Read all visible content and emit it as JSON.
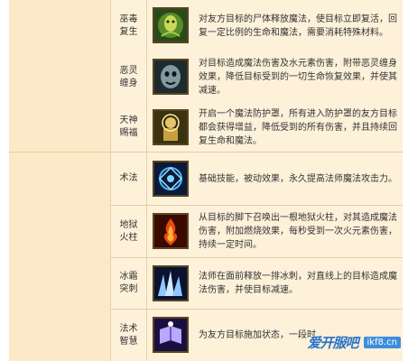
{
  "skills": [
    {
      "name_lines": [
        "巫毒",
        "复生"
      ],
      "icon": "voodoo-revive-icon",
      "description": "对友方目标的尸体释放魔法，使目标立即复活，回复一定比例的生命和魔法，需要消耗特殊材料。"
    },
    {
      "name_lines": [
        "恶灵",
        "缠身"
      ],
      "icon": "evil-spirit-icon",
      "description": "对目标造成魔法伤害及水元素伤害，附带恶灵缠身效果，降低目标受到的一切生命恢复效果，并使其减速。"
    },
    {
      "name_lines": [
        "天神",
        "赐福"
      ],
      "icon": "divine-blessing-icon",
      "description": "开启一个魔法防护罩，所有进入防护罩的友方目标都会获得增益，降低受到的所有伤害，并且持续回复生命和魔法。"
    },
    {
      "name_lines": [
        "术法"
      ],
      "icon": "arcane-rune-icon",
      "description": "基础技能，被动效果，永久提高法师魔法攻击力。"
    },
    {
      "name_lines": [
        "地狱",
        "火柱"
      ],
      "icon": "hellfire-pillar-icon",
      "description": "从目标的脚下召唤出一根地狱火柱，对其造成魔法伤害，附加燃烧效果，每秒受到一次火元素伤害，持续一定时间。"
    },
    {
      "name_lines": [
        "冰霜",
        "突刺"
      ],
      "icon": "frost-spike-icon",
      "description": "法师在面前释放一排冰刺，对直线上的目标造成魔法伤害，并使目标减速。"
    },
    {
      "name_lines": [
        "法术",
        "智慧"
      ],
      "icon": "spell-wisdom-icon",
      "description": "为友方目标施加状态，一段时"
    }
  ],
  "watermark": {
    "logo": "爱开服吧",
    "domain": "ikf8.cn"
  }
}
